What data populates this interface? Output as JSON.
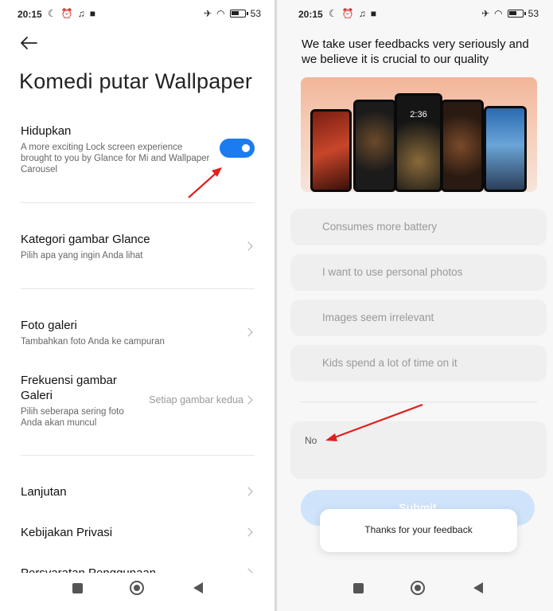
{
  "left": {
    "status": {
      "time": "20:15",
      "battery": "53"
    },
    "title": "Komedi putar Wallpaper",
    "hidupkan": {
      "title": "Hidupkan",
      "description": "A more exciting Lock screen experience brought to you by Glance for Mi and Wallpaper Carousel",
      "toggle_on": true,
      "accent": "#1a7cf0"
    },
    "rows": [
      {
        "title": "Kategori gambar Glance",
        "subtitle": "Pilih apa yang ingin Anda lihat"
      },
      {
        "title": "Foto galeri",
        "subtitle": "Tambahkan foto Anda ke campuran"
      },
      {
        "title": "Frekuensi gambar Galeri",
        "subtitle": "Pilih seberapa sering foto Anda akan muncul",
        "value": "Setiap gambar kedua"
      },
      {
        "title": "Lanjutan"
      },
      {
        "title": "Kebijakan Privasi"
      },
      {
        "title": "Persyaratan Penggunaan"
      }
    ]
  },
  "right": {
    "status": {
      "time": "20:15",
      "battery": "53"
    },
    "heading": "We take user feedbacks very seriously and we believe it is crucial to our quality",
    "phone_clock": "2:36",
    "options": [
      "Consumes more battery",
      "I want to use personal photos",
      "Images seem irrelevant",
      "Kids spend a lot of time on it"
    ],
    "input_value": "No",
    "submit_label": "Submit",
    "toast": "Thanks for your feedback"
  },
  "colors": {
    "annotation_arrow": "#e02020",
    "toggle": "#1a7cf0",
    "submit_bg": "#cfe3fb"
  }
}
